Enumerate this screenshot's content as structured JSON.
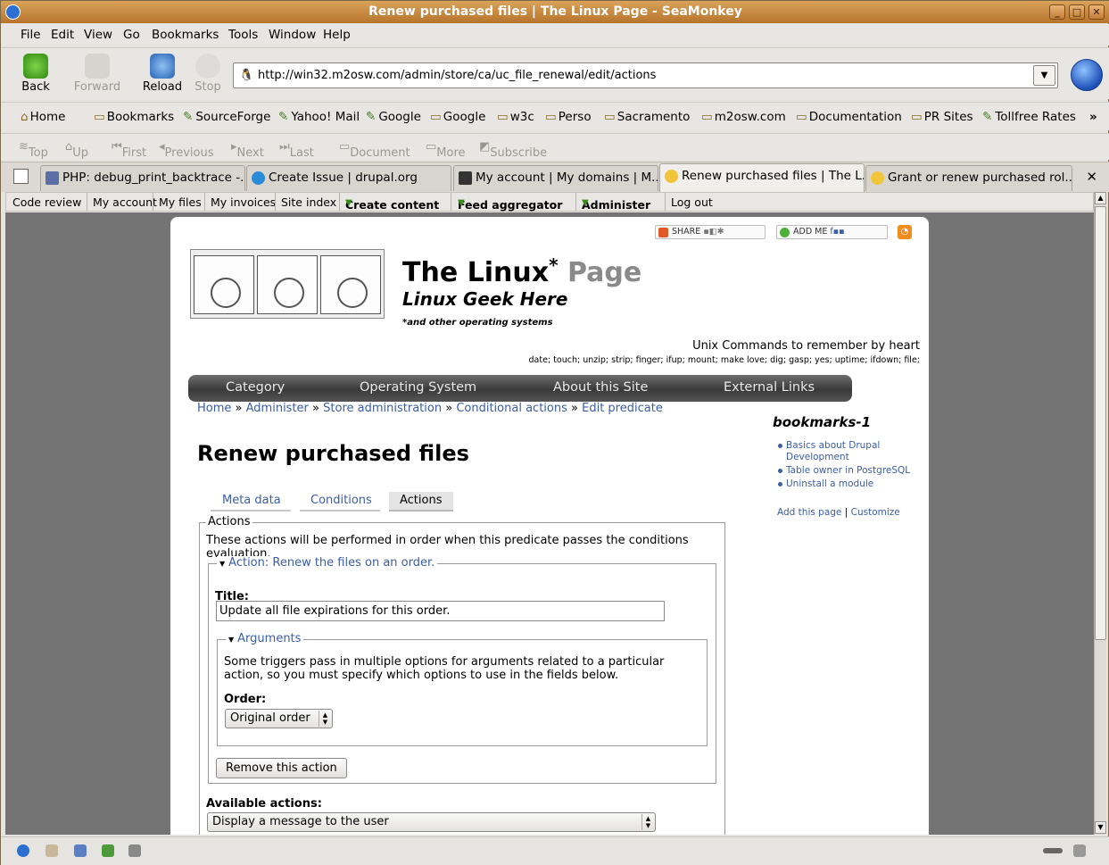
{
  "window": {
    "title": "Renew purchased files | The Linux Page - SeaMonkey"
  },
  "menu": [
    "File",
    "Edit",
    "View",
    "Go",
    "Bookmarks",
    "Tools",
    "Window",
    "Help"
  ],
  "nav": {
    "back": "Back",
    "forward": "Forward",
    "reload": "Reload",
    "stop": "Stop"
  },
  "url": "http://win32.m2osw.com/admin/store/ca/uc_file_renewal/edit/actions",
  "bookmarks": [
    "Home",
    "Bookmarks",
    "SourceForge",
    "Yahoo! Mail",
    "Google",
    "Google",
    "w3c",
    "Perso",
    "Sacramento",
    "m2osw.com",
    "Documentation",
    "PR Sites",
    "Tollfree Rates"
  ],
  "bookmarks_more": "»",
  "pagenav": [
    "Top",
    "Up",
    "First",
    "Previous",
    "Next",
    "Last",
    "Document",
    "More",
    "Subscribe"
  ],
  "tabs": [
    {
      "label": "PHP: debug_print_backtrace -...",
      "active": false
    },
    {
      "label": "Create Issue | drupal.org",
      "active": false
    },
    {
      "label": "My account | My domains | M...",
      "active": false
    },
    {
      "label": "Renew purchased files | The L...",
      "active": true
    },
    {
      "label": "Grant or renew purchased rol...",
      "active": false
    }
  ],
  "tab_close": "✕",
  "adminmenu": [
    "Code review",
    "My account",
    "My files",
    "My invoices",
    "Site index",
    "Create content",
    "Feed aggregator",
    "Administer",
    "Log out"
  ],
  "share": {
    "share": "SHARE",
    "addme": "ADD ME"
  },
  "site": {
    "name": "The Linux",
    "star": "*",
    "name2": "Page",
    "slogan": "Linux Geek Here",
    "footnote": "*and other operating systems",
    "unix_heading": "Unix Commands to remember by heart",
    "unix_commands": "date; touch; unzip; strip; finger; ifup; mount; make love; dig; gasp; yes; uptime; ifdown; file;"
  },
  "mainnav": [
    "Category",
    "Operating System",
    "About this Site",
    "External Links"
  ],
  "breadcrumb": [
    "Home",
    "Administer",
    "Store administration",
    "Conditional actions",
    "Edit predicate"
  ],
  "breadcrumb_sep": "»",
  "page_title": "Renew purchased files",
  "local_tabs": [
    "Meta data",
    "Conditions",
    "Actions"
  ],
  "form": {
    "fieldset_legend": "Actions",
    "fieldset_desc": "These actions will be performed in order when this predicate passes the conditions evaluation.",
    "action_legend": "Action: Renew the files on an order.",
    "title_label": "Title:",
    "title_value": "Update all file expirations for this order.",
    "args_legend": "Arguments",
    "args_desc": "Some triggers pass in multiple options for arguments related to a particular action, so you must specify which options to use in the fields below.",
    "order_label": "Order:",
    "order_value": "Original order",
    "remove_button": "Remove this action",
    "available_label": "Available actions:",
    "available_value": "Display a message to the user"
  },
  "sidebar": {
    "title": "bookmarks-1",
    "items": [
      "Basics about Drupal Development",
      "Table owner in PostgreSQL",
      "Uninstall a module"
    ],
    "add": "Add this page",
    "sep": "|",
    "customize": "Customize"
  }
}
